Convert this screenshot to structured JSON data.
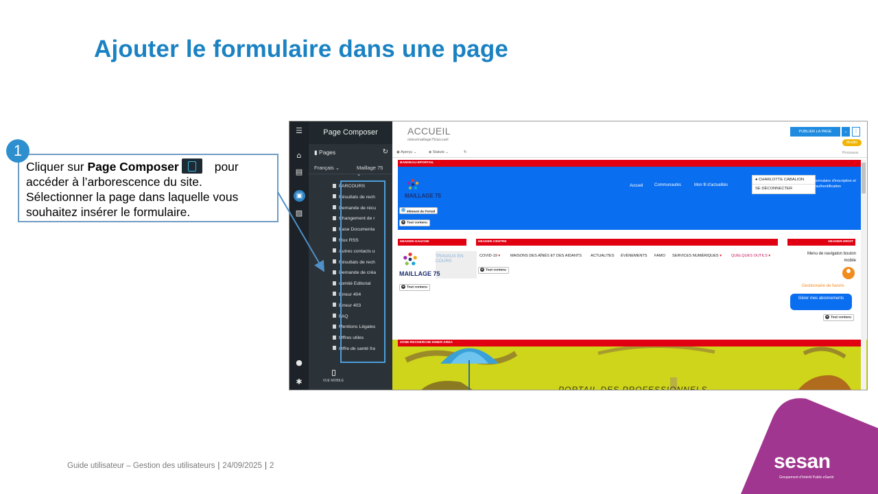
{
  "slide": {
    "title": "Ajouter le formulaire dans une page",
    "step_number": "1",
    "callout": {
      "part1": "Cliquer sur ",
      "bold": "Page Composer",
      "part2": "pour accéder à l’arborescence du site. Sélectionner la page dans laquelle vous souhaitez insérer le formulaire."
    },
    "footer": {
      "guide": "Guide utilisateur – Gestion des utilisateurs",
      "date": "24/09/2025",
      "page": "2"
    },
    "logo": {
      "name": "sesan",
      "subtitle": "Groupement d’Intérêt Public eSanté"
    },
    "colors": {
      "title": "#1a82c2",
      "accent": "#2e8fce",
      "corner": "#a0368f"
    }
  },
  "screenshot": {
    "composer": {
      "title": "Page Composer",
      "pages_label": "Pages",
      "language": "Français",
      "site": "Maillage 75",
      "tree": [
        "PARCOURS",
        "Résultats de rech",
        "Demande de récu",
        "Changement de r",
        "Base Documenta",
        "Flux RSS",
        "Autres contacts u",
        "Résultats de rech",
        "Demande de créa",
        "comité Editorial",
        "Erreur 404",
        "Erreur 403",
        "FAQ",
        "Mentions Légales",
        "Offres utiles",
        "Offre de santé fra"
      ],
      "mobile_label": "VUE MOBILE"
    },
    "main": {
      "page_title": "ACCUEIL",
      "path": "/sites/maillage75/accueil",
      "publish": "PUBLIER LA PAGE",
      "status_badge": "Modifié",
      "toolbar": {
        "preview": "Aperçu",
        "status": "Statuts",
        "process": "Processus"
      },
      "bands": {
        "top": "BANDEAU-EPORTAIL",
        "left": "HEADER-GAUCHE",
        "center": "HEADER-CENTRE",
        "right": "HEADER-DROIT",
        "search": "ZONE-RECHERCHE-INNER-AREA"
      },
      "logo_text": "MAILLAGE 75",
      "top_nav": [
        "Accueil",
        "Communautés",
        "Mon fil d'actualités"
      ],
      "user": {
        "name": "CHARLOTTE CABALION",
        "logout": "SE DÉCONNECTER"
      },
      "form_text": "Formulaire d'inscription et d'authentification",
      "element_pill": "élément de Portail",
      "add_content": "Tout contenu",
      "works_text": "TRAVAUX EN COURS",
      "center_nav": [
        "COVID-19",
        "MAISONS DES AÎNÉS ET DES AIDANTS",
        "ACTUALITES",
        "ÉVÈNEMENTS",
        "FAMO",
        "SERVICES NUMÉRIQUES",
        "QUELQUES OUTILS"
      ],
      "menu_text": "Menu de navigaton bouton mobile",
      "favorites": "Gestionnaire de favoris",
      "subscriptions_button": "Gérer mes abonnements",
      "portal_text": "PORTAIL DES PROFESSIONNELS"
    }
  }
}
